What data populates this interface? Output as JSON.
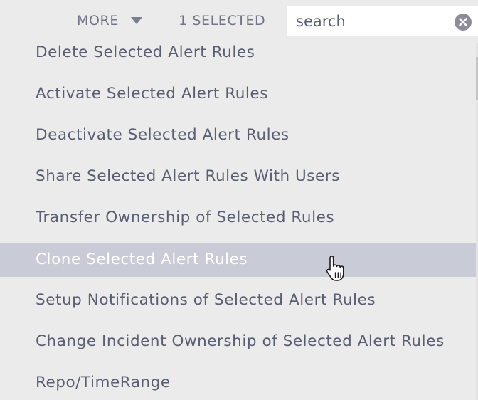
{
  "toolbar": {
    "more_label": "MORE",
    "selected_label": "1 SELECTED",
    "search": {
      "value": "",
      "placeholder": "search"
    }
  },
  "menu": {
    "items": [
      {
        "label": "Delete Selected Alert Rules"
      },
      {
        "label": "Activate Selected Alert Rules"
      },
      {
        "label": "Deactivate Selected Alert Rules"
      },
      {
        "label": "Share Selected Alert Rules With Users"
      },
      {
        "label": "Transfer Ownership of Selected Rules"
      },
      {
        "label": "Clone Selected Alert Rules",
        "highlighted": true
      },
      {
        "label": "Setup Notifications of Selected Alert Rules"
      },
      {
        "label": "Change Incident Ownership of Selected Alert Rules"
      },
      {
        "label": "Repo/TimeRange"
      }
    ]
  },
  "icons": {
    "caret": "caret-down-icon",
    "clear": "clear-icon",
    "cursor": "hand-pointer-icon"
  },
  "colors": {
    "background": "#ebebeb",
    "text": "#5a5e72",
    "toolbar_text": "#6f7486",
    "highlight_background": "#c9cbd6",
    "highlight_text": "#ffffff"
  }
}
